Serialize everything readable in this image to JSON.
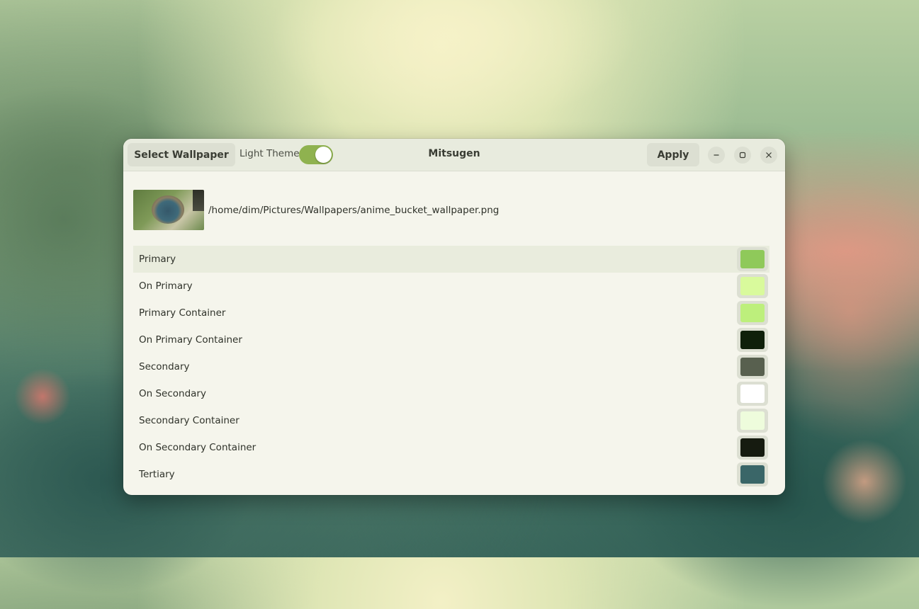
{
  "window": {
    "title": "Mitsugen"
  },
  "toolbar": {
    "select_wallpaper_label": "Select Wallpaper",
    "light_theme_label": "Light Theme",
    "light_theme_enabled": true,
    "apply_label": "Apply"
  },
  "window_controls": {
    "minimize_icon": "minimize-icon",
    "maximize_icon": "maximize-icon",
    "close_icon": "close-icon"
  },
  "wallpaper": {
    "path": "/home/dim/Pictures/Wallpapers/anime_bucket_wallpaper.png"
  },
  "palette": [
    {
      "label": "Primary",
      "color": "#8fc95a",
      "selected": true
    },
    {
      "label": "On Primary",
      "color": "#d9fa9c",
      "selected": false
    },
    {
      "label": "Primary Container",
      "color": "#bdef7c",
      "selected": false
    },
    {
      "label": "On Primary Container",
      "color": "#0f200a",
      "selected": false
    },
    {
      "label": "Secondary",
      "color": "#58604f",
      "selected": false
    },
    {
      "label": "On Secondary",
      "color": "#ffffff",
      "selected": false
    },
    {
      "label": "Secondary Container",
      "color": "#eefcdc",
      "selected": false
    },
    {
      "label": "On Secondary Container",
      "color": "#161b10",
      "selected": false
    },
    {
      "label": "Tertiary",
      "color": "#3a6668",
      "selected": false
    }
  ]
}
